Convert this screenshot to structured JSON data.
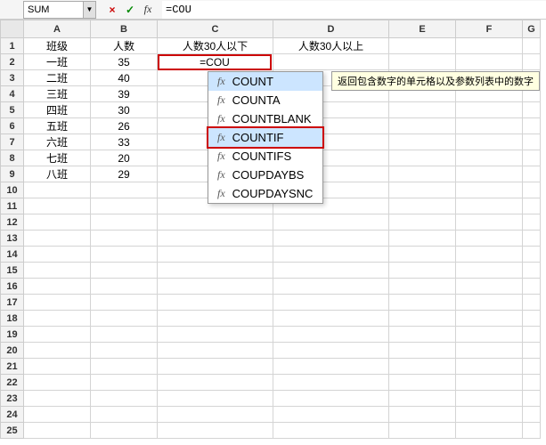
{
  "formula_bar": {
    "name_box": "SUM",
    "cancel": "×",
    "confirm": "✓",
    "fx": "fx",
    "input": "=COU"
  },
  "columns": [
    "A",
    "B",
    "C",
    "D",
    "E",
    "F",
    "G"
  ],
  "rows_count": 25,
  "data": {
    "r1": {
      "A": "班级",
      "B": "人数",
      "C": "人数30人以下",
      "D": "人数30人以上"
    },
    "r2": {
      "A": "一班",
      "B": "35",
      "C": "=COU"
    },
    "r3": {
      "A": "二班",
      "B": "40"
    },
    "r4": {
      "A": "三班",
      "B": "39"
    },
    "r5": {
      "A": "四班",
      "B": "30"
    },
    "r6": {
      "A": "五班",
      "B": "26"
    },
    "r7": {
      "A": "六班",
      "B": "33"
    },
    "r8": {
      "A": "七班",
      "B": "20"
    },
    "r9": {
      "A": "八班",
      "B": "29"
    }
  },
  "active_cell_value": "=COU",
  "autocomplete": {
    "items": [
      {
        "label": "COUNT",
        "selected": true
      },
      {
        "label": "COUNTA"
      },
      {
        "label": "COUNTBLANK"
      },
      {
        "label": "COUNTIF",
        "highlighted": true
      },
      {
        "label": "COUNTIFS"
      },
      {
        "label": "COUPDAYBS"
      },
      {
        "label": "COUPDAYSNC"
      }
    ],
    "fx": "fx"
  },
  "tooltip": "返回包含数字的单元格以及参数列表中的数字"
}
